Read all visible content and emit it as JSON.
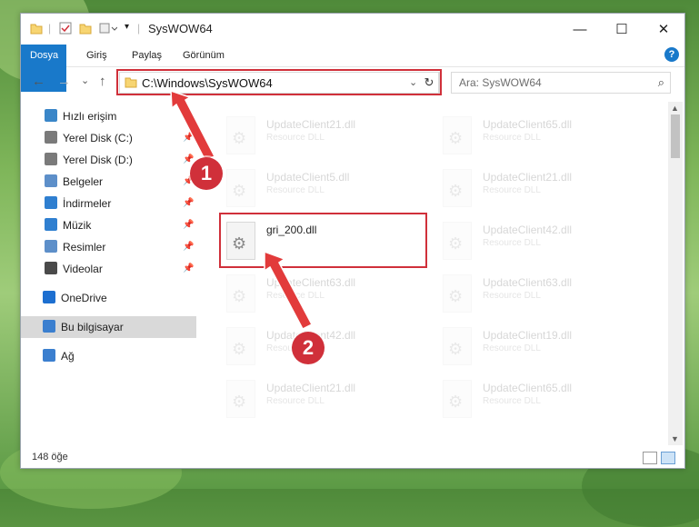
{
  "window": {
    "title": "SysWOW64",
    "controls": {
      "minimize": "—",
      "maximize": "☐",
      "close": "✕"
    }
  },
  "ribbon": {
    "tabs": [
      "Dosya",
      "Giriş",
      "Paylaş",
      "Görünüm"
    ],
    "help": "?"
  },
  "navigation": {
    "address": "C:\\Windows\\SysWOW64",
    "search_placeholder": "Ara: SysWOW64",
    "back": "←",
    "forward": "→",
    "recent": "⌄",
    "up": "↑",
    "refresh": "↻"
  },
  "sidebar": {
    "items": [
      {
        "label": "Hızlı erişim",
        "icon": "star-icon",
        "color": "#3a86c8",
        "pinned": false
      },
      {
        "label": "Yerel Disk (C:)",
        "icon": "drive-icon",
        "color": "#7a7a7a",
        "pinned": true
      },
      {
        "label": "Yerel Disk (D:)",
        "icon": "drive-icon",
        "color": "#7a7a7a",
        "pinned": true
      },
      {
        "label": "Belgeler",
        "icon": "documents-icon",
        "color": "#5d8fc9",
        "pinned": true
      },
      {
        "label": "İndirmeler",
        "icon": "downloads-icon",
        "color": "#2f7fd0",
        "pinned": true
      },
      {
        "label": "Müzik",
        "icon": "music-icon",
        "color": "#2f7fd0",
        "pinned": true
      },
      {
        "label": "Resimler",
        "icon": "pictures-icon",
        "color": "#5d8fc9",
        "pinned": true
      },
      {
        "label": "Videolar",
        "icon": "videos-icon",
        "color": "#4a4a4a",
        "pinned": true
      },
      {
        "label": "OneDrive",
        "icon": "cloud-icon",
        "color": "#1d6fd0",
        "pinned": false
      },
      {
        "label": "Bu bilgisayar",
        "icon": "computer-icon",
        "color": "#3b7fcf",
        "pinned": false,
        "selected": true
      },
      {
        "label": "Ağ",
        "icon": "network-icon",
        "color": "#3b7fcf",
        "pinned": false
      }
    ]
  },
  "files": [
    {
      "name": "UpdateClient21.dll",
      "type": "Resource DLL",
      "faded": true
    },
    {
      "name": "UpdateClient65.dll",
      "type": "Resource DLL",
      "faded": true
    },
    {
      "name": "UpdateClient5.dll",
      "type": "Resource DLL",
      "faded": true
    },
    {
      "name": "UpdateClient21.dll",
      "type": "Resource DLL",
      "faded": true
    },
    {
      "name": "gri_200.dll",
      "type": "",
      "faded": false,
      "highlighted": true
    },
    {
      "name": "UpdateClient42.dll",
      "type": "Resource DLL",
      "faded": true
    },
    {
      "name": "UpdateClient63.dll",
      "type": "Resource DLL",
      "faded": true
    },
    {
      "name": "UpdateClient63.dll",
      "type": "Resource DLL",
      "faded": true
    },
    {
      "name": "UpdateClient42.dll",
      "type": "Resource DLL",
      "faded": true
    },
    {
      "name": "UpdateClient19.dll",
      "type": "Resource DLL",
      "faded": true
    },
    {
      "name": "UpdateClient21.dll",
      "type": "Resource DLL",
      "faded": true
    },
    {
      "name": "UpdateClient65.dll",
      "type": "Resource DLL",
      "faded": true
    }
  ],
  "status": {
    "item_count": "148 öğe"
  },
  "annotations": {
    "step1": "1",
    "step2": "2",
    "color": "#d0303a"
  }
}
